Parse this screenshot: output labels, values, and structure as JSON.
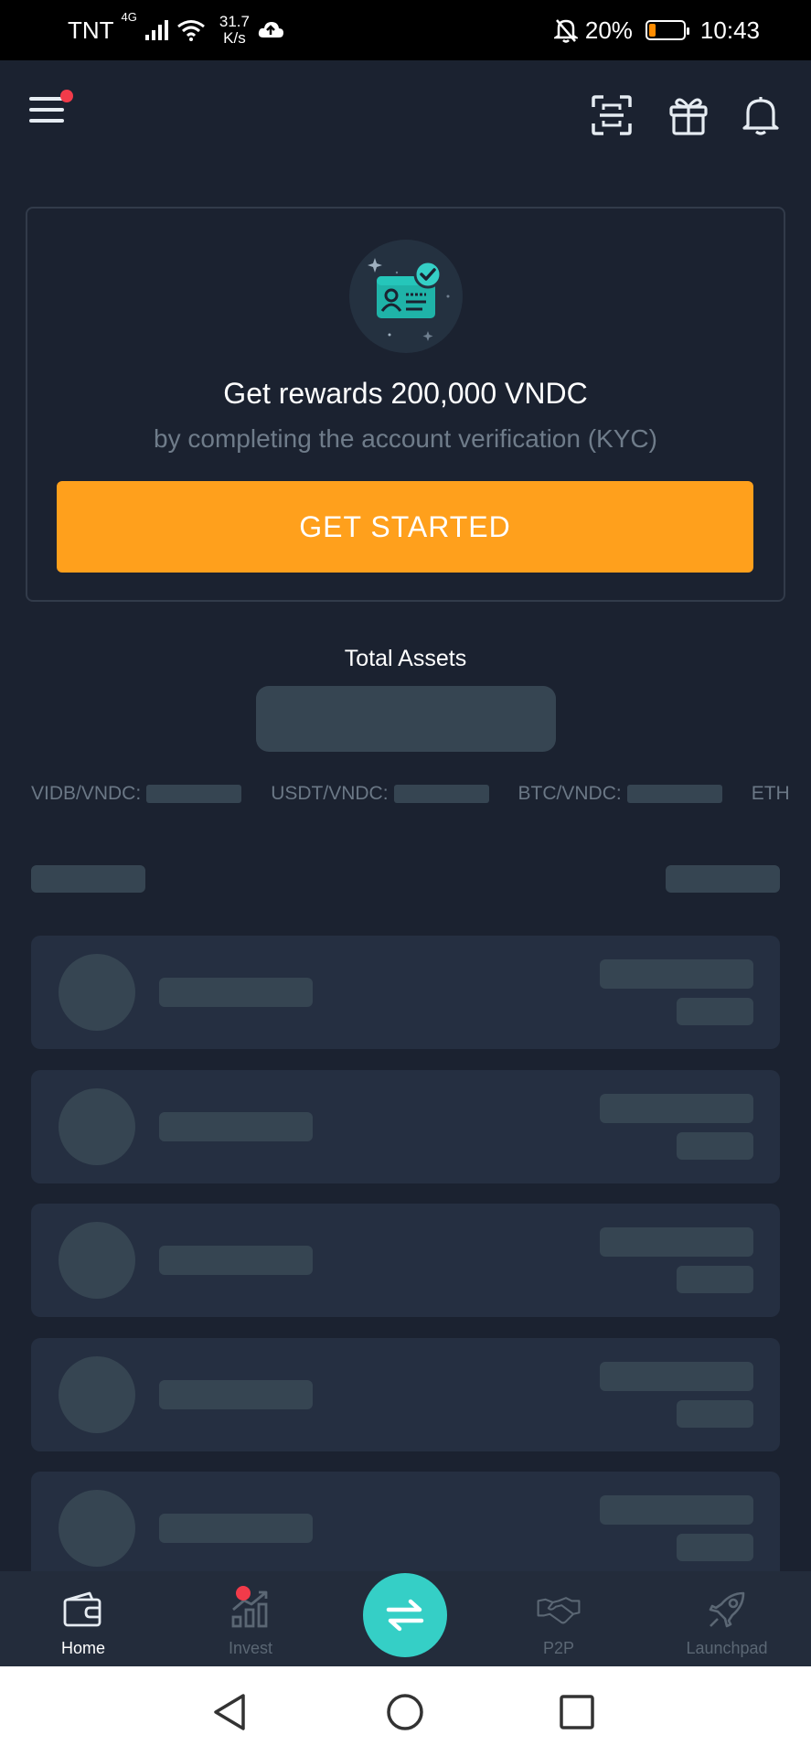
{
  "status_bar": {
    "carrier": "TNT",
    "network_type": "4G",
    "net_speed_value": "31.7",
    "net_speed_unit": "K/s",
    "battery": "20%",
    "battery_level": 0.2,
    "time": "10:43"
  },
  "top_nav": {
    "menu_icon": "hamburger-menu-icon",
    "scan_icon": "scan-icon",
    "gift_icon": "gift-icon",
    "bell_icon": "bell-icon"
  },
  "kyc": {
    "badge_icon": "id-card-verified-icon",
    "title": "Get rewards 200,000 VNDC",
    "subtitle": "by completing the account verification (KYC)",
    "button_label": "GET STARTED"
  },
  "assets": {
    "total_label": "Total Assets"
  },
  "ticker": [
    {
      "pair": "VIDB/VNDC:"
    },
    {
      "pair": "USDT/VNDC:"
    },
    {
      "pair": "BTC/VNDC:"
    },
    {
      "pair": "ETH"
    }
  ],
  "bottom_nav": {
    "items": [
      {
        "label": "Home",
        "icon": "wallet-icon",
        "active": true
      },
      {
        "label": "Invest",
        "icon": "chart-icon",
        "active": false
      },
      {
        "label": "P2P",
        "icon": "handshake-icon",
        "active": false
      },
      {
        "label": "Launchpad",
        "icon": "rocket-icon",
        "active": false
      }
    ],
    "swap_icon": "swap-arrows-icon"
  },
  "colors": {
    "background": "#1b2230",
    "accent": "#ffa01c",
    "swap": "#35cfc6",
    "notification": "#f23b4a"
  }
}
